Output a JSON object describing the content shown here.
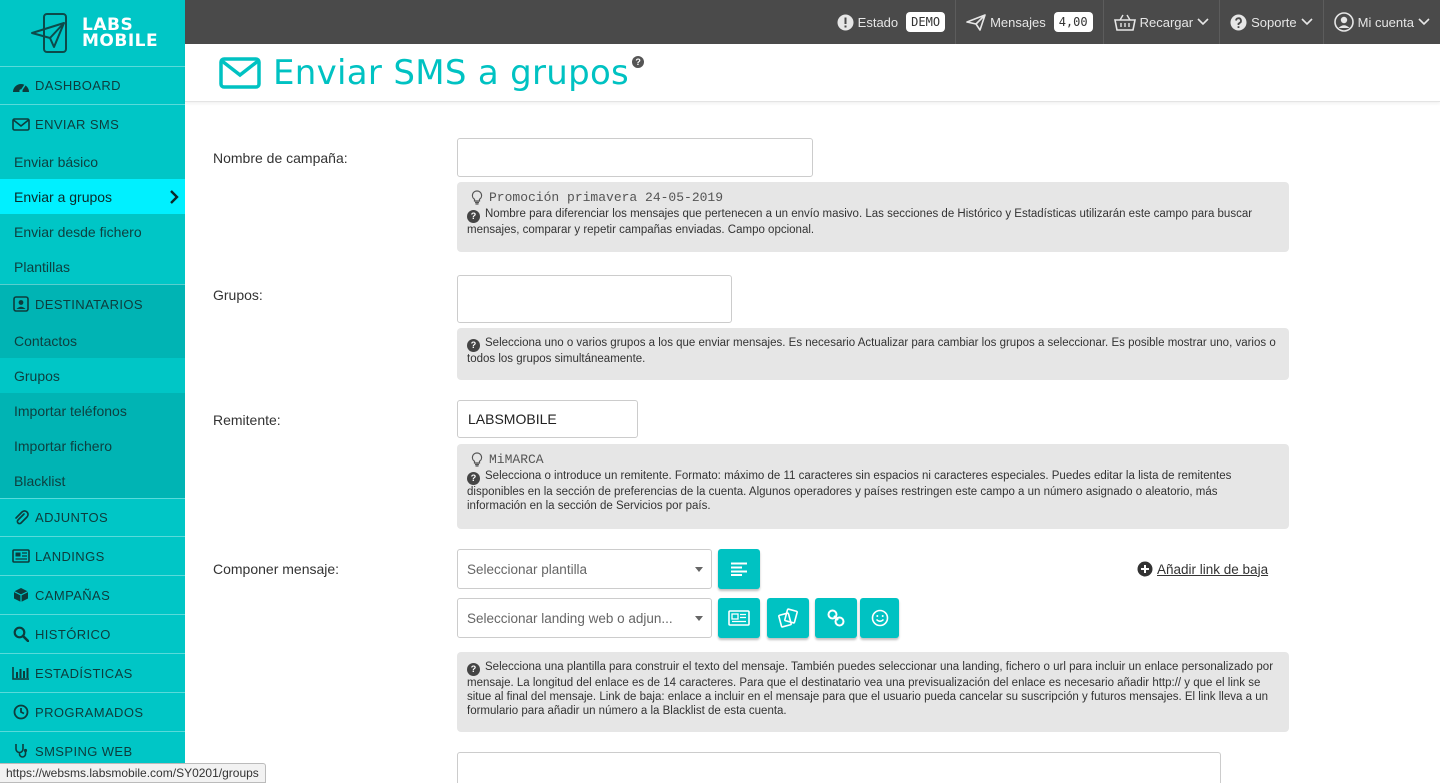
{
  "logo": {
    "line1": "LABS",
    "line2": "MOBILE"
  },
  "sidebar": {
    "dashboard": "DASHBOARD",
    "enviar_sms": "ENVIAR SMS",
    "enviar_items": [
      "Enviar básico",
      "Enviar a grupos",
      "Enviar desde fichero",
      "Plantillas"
    ],
    "destinatarios": "DESTINATARIOS",
    "destinatarios_items": [
      "Contactos",
      "Grupos",
      "Importar teléfonos",
      "Importar fichero",
      "Blacklist"
    ],
    "adjuntos": "ADJUNTOS",
    "landings": "LANDINGS",
    "campanas": "CAMPAÑAS",
    "historico": "HISTÓRICO",
    "estadisticas": "ESTADÍSTICAS",
    "programados": "PROGRAMADOS",
    "smsping": "SMSPING WEB"
  },
  "topbar": {
    "estado_label": "Estado",
    "estado_value": "DEMO",
    "mensajes_label": "Mensajes",
    "mensajes_value": "4,00",
    "recargar": "Recargar",
    "soporte": "Soporte",
    "cuenta": "Mi cuenta"
  },
  "page": {
    "title": "Enviar SMS a grupos"
  },
  "form": {
    "campana": {
      "label": "Nombre de campaña:",
      "value": "",
      "example": "Promoción primavera 24-05-2019",
      "help": "Nombre para diferenciar los mensajes que pertenecen a un envío masivo. Las secciones de Histórico y Estadísticas utilizarán este campo para buscar mensajes, comparar y repetir campañas enviadas. Campo opcional."
    },
    "grupos": {
      "label": "Grupos:",
      "value": "",
      "help": "Selecciona uno o varios grupos a los que enviar mensajes. Es necesario Actualizar para cambiar los grupos a seleccionar. Es posible mostrar uno, varios o todos los grupos simultáneamente."
    },
    "remitente": {
      "label": "Remitente:",
      "value": "LABSMOBILE",
      "example": "MiMARCA",
      "help": "Selecciona o introduce un remitente. Formato: máximo de 11 caracteres sin espacios ni caracteres especiales. Puedes editar la lista de remitentes disponibles en la sección de preferencias de la cuenta. Algunos operadores y países restringen este campo a un número asignado o aleatorio, más información en la sección de Servicios por país."
    },
    "mensaje": {
      "label": "Componer mensaje:",
      "plantilla_placeholder": "Seleccionar plantilla",
      "landing_placeholder": "Seleccionar landing web o adjun...",
      "unsub_link": "Añadir link de baja",
      "help": "Selecciona una plantilla para construir el texto del mensaje. También puedes seleccionar una landing, fichero o url para incluir un enlace personalizado por mensaje. La longitud del enlace es de 14 caracteres. Para que el destinatario vea una previsualización del enlace es necesario añadir http:// y que el link se situe al final del mensaje. Link de baja: enlace a incluir en el mensaje para que el usuario pueda cancelar su suscripción y futuros mensajes. El link lleva a un formulario para añadir un número a la Blacklist de esta cuenta."
    }
  },
  "statusbar": {
    "url": "https://websms.labsmobile.com/SY0201/groups"
  },
  "colors": {
    "accent": "#00c6c6",
    "active": "#00f0ff",
    "topbar": "#4a4a4a"
  }
}
